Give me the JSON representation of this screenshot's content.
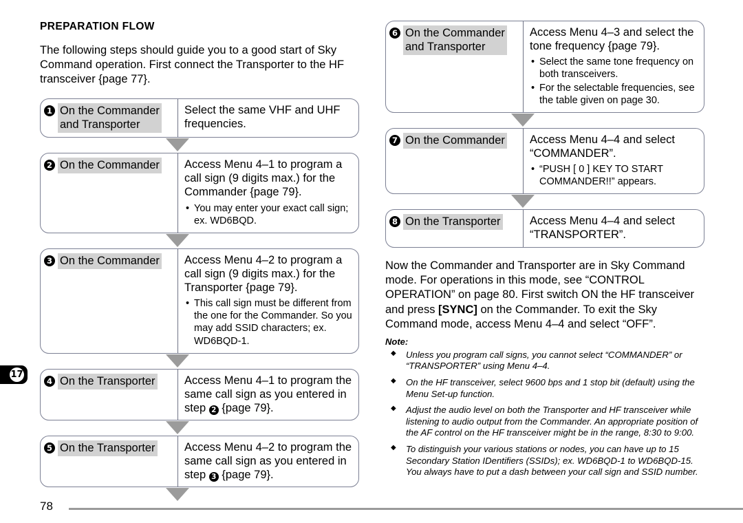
{
  "page": {
    "number": "78",
    "chapter_tab": "17"
  },
  "left": {
    "section_title": "PREPARATION FLOW",
    "intro": "The following steps should guide you to a good start of Sky Command operation.  First connect the Transporter to the HF transceiver {page 77}.",
    "steps": [
      {
        "num": "1",
        "role": "On the Commander\nand Transporter",
        "action": "Select the same VHF and UHF frequencies.",
        "bullets": []
      },
      {
        "num": "2",
        "role": "On the Commander",
        "action": "Access Menu 4–1 to program a call sign (9 digits max.) for the Commander {page 79}.",
        "bullets": [
          "You may enter your exact call sign; ex. WD6BQD."
        ]
      },
      {
        "num": "3",
        "role": "On the Commander",
        "action": "Access Menu 4–2 to program a call sign (9 digits max.) for the Transporter {page 79}.",
        "bullets": [
          "This call sign must be different from the one for the Commander.  So you may add SSID characters; ex. WD6BQD-1."
        ]
      },
      {
        "num": "4",
        "role": "On the Transporter",
        "action_pre": "Access Menu 4–1 to program the same call sign as you entered in step ",
        "action_ref": "2",
        "action_post": " {page 79}.",
        "bullets": []
      },
      {
        "num": "5",
        "role": "On the Transporter",
        "action_pre": "Access Menu 4–2 to program the same call sign as you entered in step ",
        "action_ref": "3",
        "action_post": " {page 79}.",
        "bullets": []
      }
    ]
  },
  "right": {
    "steps": [
      {
        "num": "6",
        "role": "On the Commander\nand Transporter",
        "action": "Access Menu 4–3 and select the tone frequency {page 79}.",
        "bullets": [
          "Select the same tone frequency on both transceivers.",
          "For the selectable frequencies, see the table given on page 30."
        ]
      },
      {
        "num": "7",
        "role": "On the Commander",
        "action": "Access Menu 4–4 and select “COMMANDER”.",
        "bullets": [
          "“PUSH [ 0 ] KEY TO START COMMANDER!!” appears."
        ]
      },
      {
        "num": "8",
        "role": "On the Transporter",
        "action": "Access Menu 4–4 and select “TRANSPORTER”.",
        "bullets": []
      }
    ],
    "closing_pre": "Now the Commander and Transporter are in Sky Command mode.  For operations in this mode, see “CONTROL OPERATION” on page 80.  First switch ON the HF transceiver and press ",
    "closing_key": "[SYNC]",
    "closing_post": " on the Commander.  To exit the Sky Command mode, access Menu 4–4 and select “OFF”.",
    "note_heading": "Note:",
    "notes": [
      "Unless you program call signs, you cannot select “COMMANDER” or “TRANSPORTER” using Menu 4–4.",
      "On the HF transceiver, select 9600 bps and 1 stop bit (default) using the Menu Set-up function.",
      "Adjust the audio level on both the Transporter and HF transceiver while listening to audio output from the Commander.  An appropriate position of the AF control on the HF transceiver might be in the range, 8:30 to 9:00.",
      "To distinguish your various stations or nodes, you can have up to 15 Secondary Station IDentifiers (SSIDs); ex. WD6BQD-1 to WD6BQD-15.  You always have to put a dash between your call sign and SSID number."
    ]
  },
  "colors": {
    "box_border": "#7b7f93",
    "role_fill": "#d2d2d2",
    "arrow": "#9b9b9b",
    "rule": "#9a9a9a"
  }
}
